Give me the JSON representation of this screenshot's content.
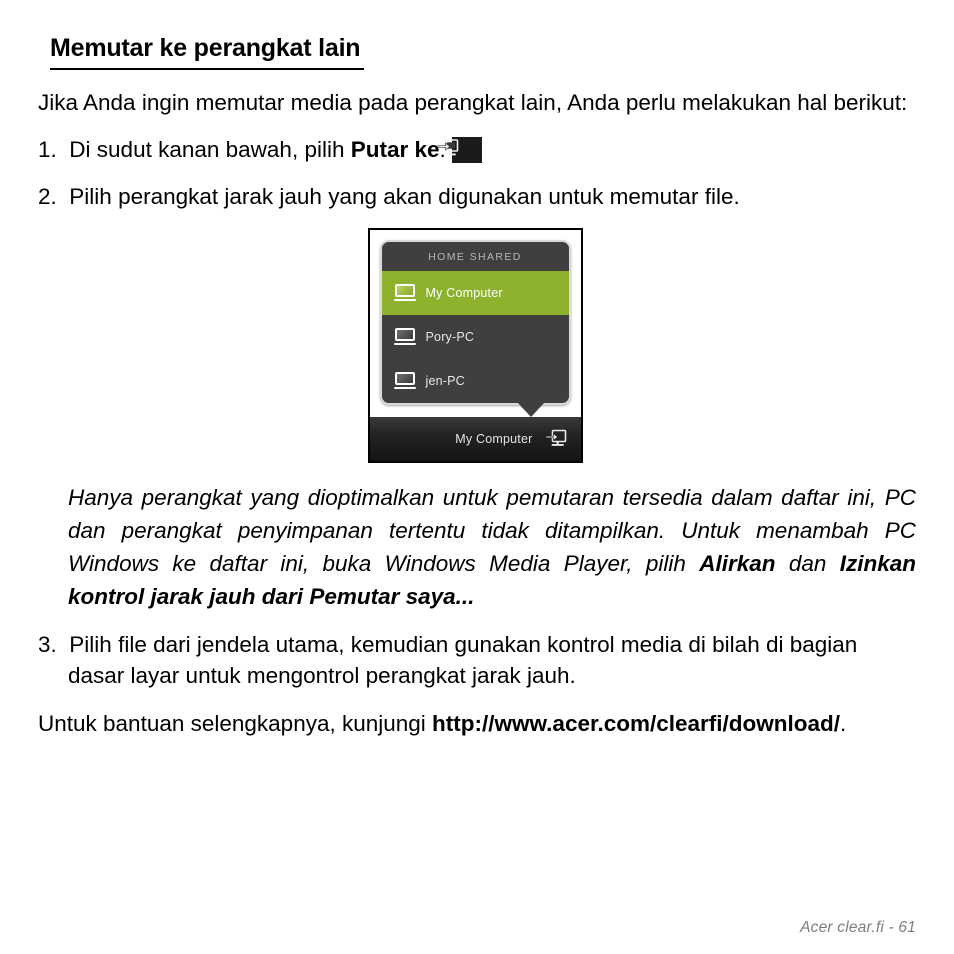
{
  "document": {
    "heading": "Memutar ke perangkat lain",
    "intro": {
      "text_before": "Jika Anda ingin memutar media pada perangkat lain, Anda perlu melakukan hal berikut:"
    },
    "steps": [
      {
        "number": "1.",
        "text_before": "Di sudut kanan bawah, pilih ",
        "bold": "Putar ke",
        "text_after": ".",
        "icon": "cast-to-device-icon"
      },
      {
        "number": "2.",
        "text_before": "Pilih perangkat jarak jauh yang akan digunakan untuk memutar file.",
        "bold": "",
        "text_after": ""
      },
      {
        "number": "3.",
        "text_before": "Pilih file dari jendela utama, kemudian gunakan kontrol media di bilah di bagian dasar layar untuk mengontrol perangkat jarak jauh.",
        "bold": "",
        "text_after": ""
      }
    ],
    "note": {
      "seg1": "Hanya perangkat yang dioptimalkan untuk pemutaran tersedia dalam daftar ini, PC dan perangkat penyimpanan tertentu tidak ditampilkan. Untuk menambah PC Windows ke daftar ini, buka Windows Media Player, pilih ",
      "bold1": "Alirkan",
      "seg2": " dan ",
      "bold2": "Izinkan kontrol jarak jauh dari Pemutar saya..."
    },
    "closing": {
      "seg1": "Untuk bantuan selengkapnya, kunjungi ",
      "link": "http://www.acer.com/clearfi/download/",
      "seg2": "."
    },
    "footer": "Acer clear.fi -  61"
  },
  "figure": {
    "popup": {
      "title": "HOME SHARED",
      "devices": [
        {
          "label": "My Computer",
          "selected": true,
          "icon": "laptop-icon"
        },
        {
          "label": "Pory-PC",
          "selected": false,
          "icon": "laptop-icon"
        },
        {
          "label": "jen-PC",
          "selected": false,
          "icon": "laptop-icon"
        }
      ]
    },
    "bottom_bar": {
      "label": "My Computer",
      "icon": "cast-to-device-icon"
    }
  },
  "colors": {
    "accent_green": "#8cb22e",
    "popup_bg": "#3f3f3f",
    "popup_border": "#d9d9d9",
    "bottom_bar_bg": "#1c1c1c",
    "footer_text": "#7d7d7d"
  }
}
